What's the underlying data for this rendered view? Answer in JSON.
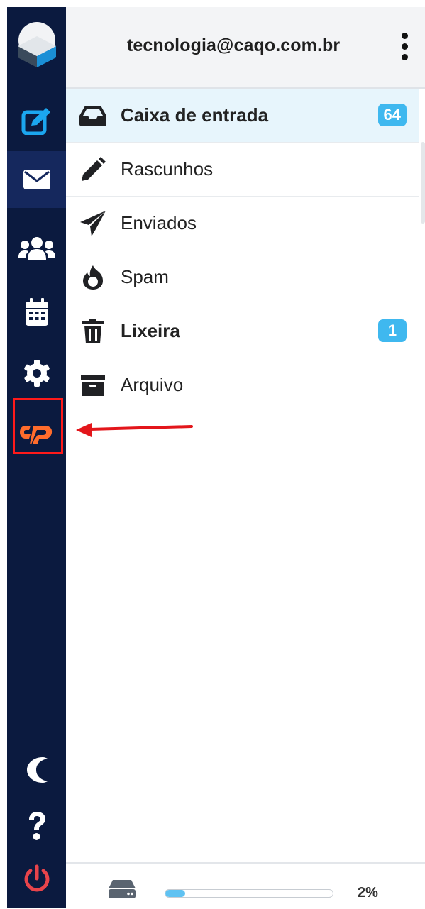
{
  "header": {
    "account": "tecnologia@caqo.com.br",
    "menu_icon": "kebab-menu-icon"
  },
  "nav": {
    "items": [
      {
        "name": "compose",
        "icon": "compose-icon",
        "active": false
      },
      {
        "name": "mail",
        "icon": "envelope-icon",
        "active": true
      },
      {
        "name": "contacts",
        "icon": "users-icon",
        "active": false
      },
      {
        "name": "calendar",
        "icon": "calendar-icon",
        "active": false
      },
      {
        "name": "settings",
        "icon": "gear-icon",
        "active": false
      },
      {
        "name": "cpanel",
        "icon": "cpanel-icon",
        "active": false
      },
      {
        "name": "dark-mode",
        "icon": "moon-icon",
        "active": false
      },
      {
        "name": "help",
        "icon": "question-icon",
        "active": false
      },
      {
        "name": "logout",
        "icon": "power-icon",
        "active": false
      }
    ]
  },
  "folders": [
    {
      "label": "Caixa de entrada",
      "icon": "inbox-icon",
      "badge": "64",
      "bold": true,
      "selected": true
    },
    {
      "label": "Rascunhos",
      "icon": "pencil-icon",
      "badge": "",
      "bold": false,
      "selected": false
    },
    {
      "label": "Enviados",
      "icon": "paper-plane-icon",
      "badge": "",
      "bold": false,
      "selected": false
    },
    {
      "label": "Spam",
      "icon": "fire-icon",
      "badge": "",
      "bold": false,
      "selected": false
    },
    {
      "label": "Lixeira",
      "icon": "trash-icon",
      "badge": "1",
      "bold": true,
      "selected": false
    },
    {
      "label": "Arquivo",
      "icon": "archive-icon",
      "badge": "",
      "bold": false,
      "selected": false
    }
  ],
  "quota": {
    "percent_label": "2%",
    "percent": 2,
    "icon": "hard-drive-icon"
  },
  "colors": {
    "nav_bg": "#0b1a3f",
    "accent": "#3fb8ef",
    "cpanel": "#ff6c2c",
    "power": "#e8444b",
    "highlight": "#ff1a1a"
  }
}
